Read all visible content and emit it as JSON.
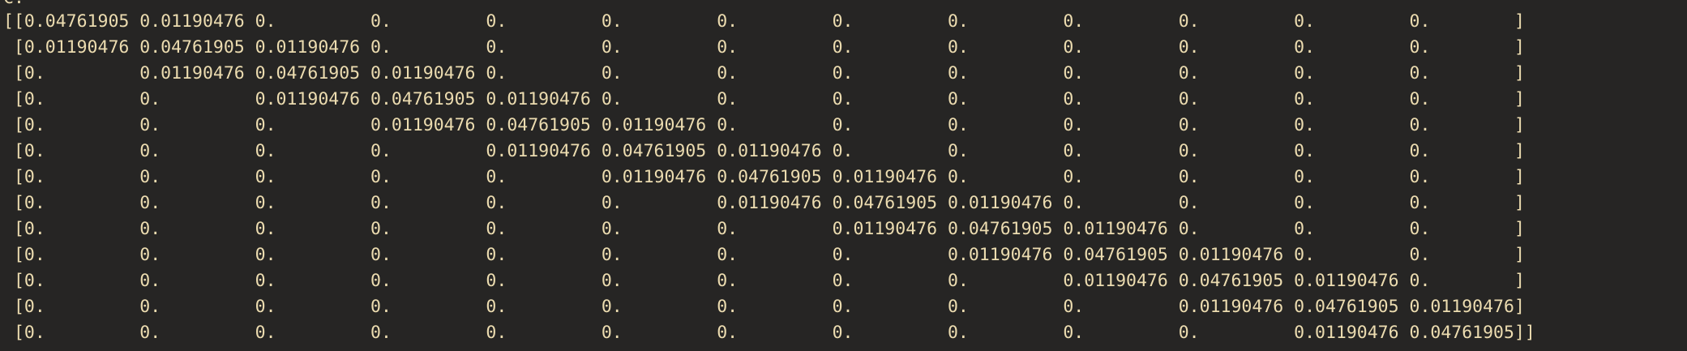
{
  "terminal": {
    "header_fragment": "C.",
    "matrix_rows": [
      "[[0.04761905 0.01190476 0.         0.         0.         0.         0.         0.         0.         0.         0.         0.         0.        ]",
      " [0.01190476 0.04761905 0.01190476 0.         0.         0.         0.         0.         0.         0.         0.         0.         0.        ]",
      " [0.         0.01190476 0.04761905 0.01190476 0.         0.         0.         0.         0.         0.         0.         0.         0.        ]",
      " [0.         0.         0.01190476 0.04761905 0.01190476 0.         0.         0.         0.         0.         0.         0.         0.        ]",
      " [0.         0.         0.         0.01190476 0.04761905 0.01190476 0.         0.         0.         0.         0.         0.         0.        ]",
      " [0.         0.         0.         0.         0.01190476 0.04761905 0.01190476 0.         0.         0.         0.         0.         0.        ]",
      " [0.         0.         0.         0.         0.         0.01190476 0.04761905 0.01190476 0.         0.         0.         0.         0.        ]",
      " [0.         0.         0.         0.         0.         0.         0.01190476 0.04761905 0.01190476 0.         0.         0.         0.        ]",
      " [0.         0.         0.         0.         0.         0.         0.         0.01190476 0.04761905 0.01190476 0.         0.         0.        ]",
      " [0.         0.         0.         0.         0.         0.         0.         0.         0.01190476 0.04761905 0.01190476 0.         0.        ]",
      " [0.         0.         0.         0.         0.         0.         0.         0.         0.         0.01190476 0.04761905 0.01190476 0.        ]",
      " [0.         0.         0.         0.         0.         0.         0.         0.         0.         0.         0.01190476 0.04761905 0.01190476]",
      " [0.         0.         0.         0.         0.         0.         0.         0.         0.         0.         0.         0.01190476 0.04761905]]"
    ]
  }
}
